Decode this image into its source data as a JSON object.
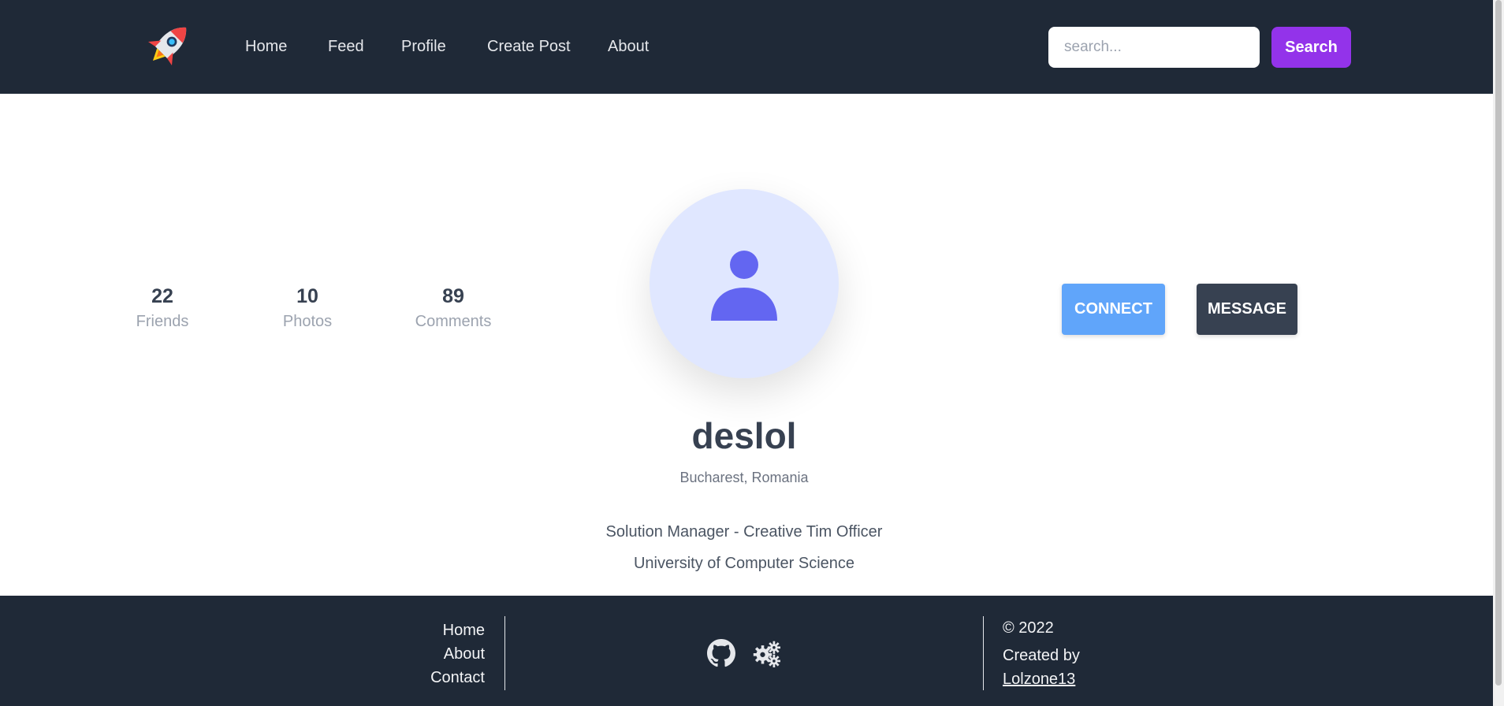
{
  "nav": {
    "links": [
      "Home",
      "Feed",
      "Profile",
      "Create Post",
      "About"
    ],
    "search_placeholder": "search...",
    "search_button": "Search"
  },
  "profile": {
    "stats": [
      {
        "value": "22",
        "label": "Friends"
      },
      {
        "value": "10",
        "label": "Photos"
      },
      {
        "value": "89",
        "label": "Comments"
      }
    ],
    "connect_label": "CONNECT",
    "message_label": "MESSAGE",
    "username": "deslol",
    "location": "Bucharest, Romania",
    "job": "Solution Manager - Creative Tim Officer",
    "school": "University of Computer Science"
  },
  "footer": {
    "links": [
      "Home",
      "About",
      "Contact"
    ],
    "copyright": "© 2022",
    "created_by": "Created by",
    "author": "Lolzone13",
    "icons": [
      "github-icon",
      "gears-icon"
    ]
  },
  "colors": {
    "nav_bg": "#1f2937",
    "search_button": "#9333ea",
    "connect_button": "#60a5fa",
    "message_button": "#374151",
    "avatar_bg": "#e0e7ff",
    "avatar_fg": "#6366f1"
  }
}
